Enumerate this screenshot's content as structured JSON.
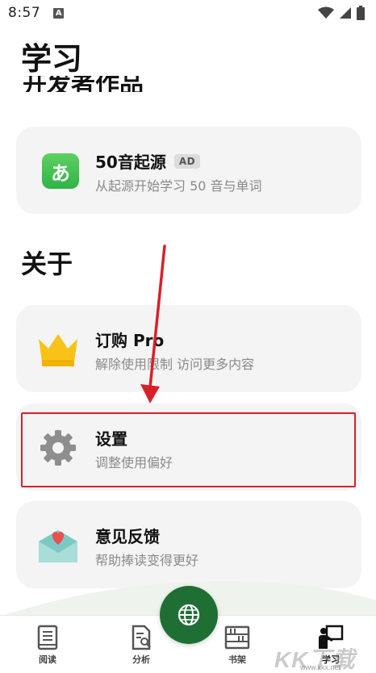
{
  "status_bar": {
    "time": "8:57",
    "notification_letter": "A"
  },
  "page": {
    "title": "学习"
  },
  "section_developer": {
    "title": "开发者作品"
  },
  "app_card": {
    "title": "50音起源",
    "badge": "AD",
    "subtitle": "从起源开始学习 50 音与单词",
    "icon_glyph": "あ"
  },
  "section_about": {
    "title": "关于"
  },
  "subscribe_card": {
    "title": "订购 Pro",
    "subtitle": "解除使用限制 访问更多内容"
  },
  "settings_card": {
    "title": "设置",
    "subtitle": "调整使用偏好"
  },
  "feedback_card": {
    "title": "意见反馈",
    "subtitle": "帮助捧读变得更好"
  },
  "tabs": [
    {
      "label": "阅读",
      "icon": "book-icon"
    },
    {
      "label": "分析",
      "icon": "document-search-icon"
    },
    {
      "label": "书架",
      "icon": "bookshelf-icon"
    },
    {
      "label": "学习",
      "icon": "teacher-board-icon"
    }
  ],
  "watermark": {
    "text": "KK下载",
    "url": "www.kkx.net"
  },
  "colors": {
    "accent_green": "#1f6f34",
    "highlight_red": "#d8202a",
    "card_bg": "#f4f4f4"
  }
}
